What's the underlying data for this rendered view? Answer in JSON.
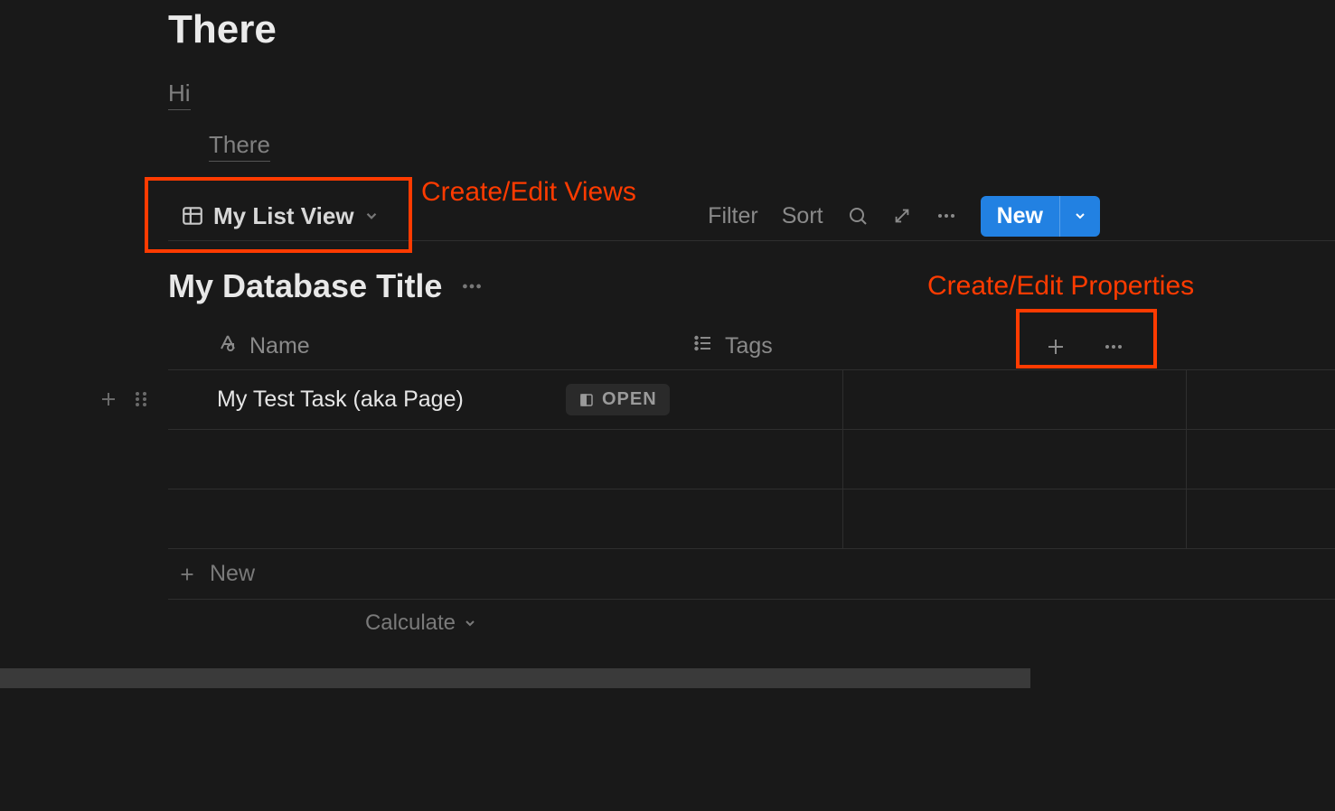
{
  "page": {
    "title": "There"
  },
  "breadcrumb": {
    "level1": "Hi",
    "level2": "There"
  },
  "view": {
    "name": "My List View"
  },
  "toolbar": {
    "filter": "Filter",
    "sort": "Sort",
    "new": "New"
  },
  "database": {
    "title": "My Database Title"
  },
  "columns": {
    "name": "Name",
    "tags": "Tags"
  },
  "rows": [
    {
      "title": "My Test Task (aka Page)",
      "open_label": "OPEN"
    }
  ],
  "add_row": "New",
  "calculate": "Calculate",
  "annotations": {
    "views": "Create/Edit Views",
    "properties": "Create/Edit Properties"
  }
}
